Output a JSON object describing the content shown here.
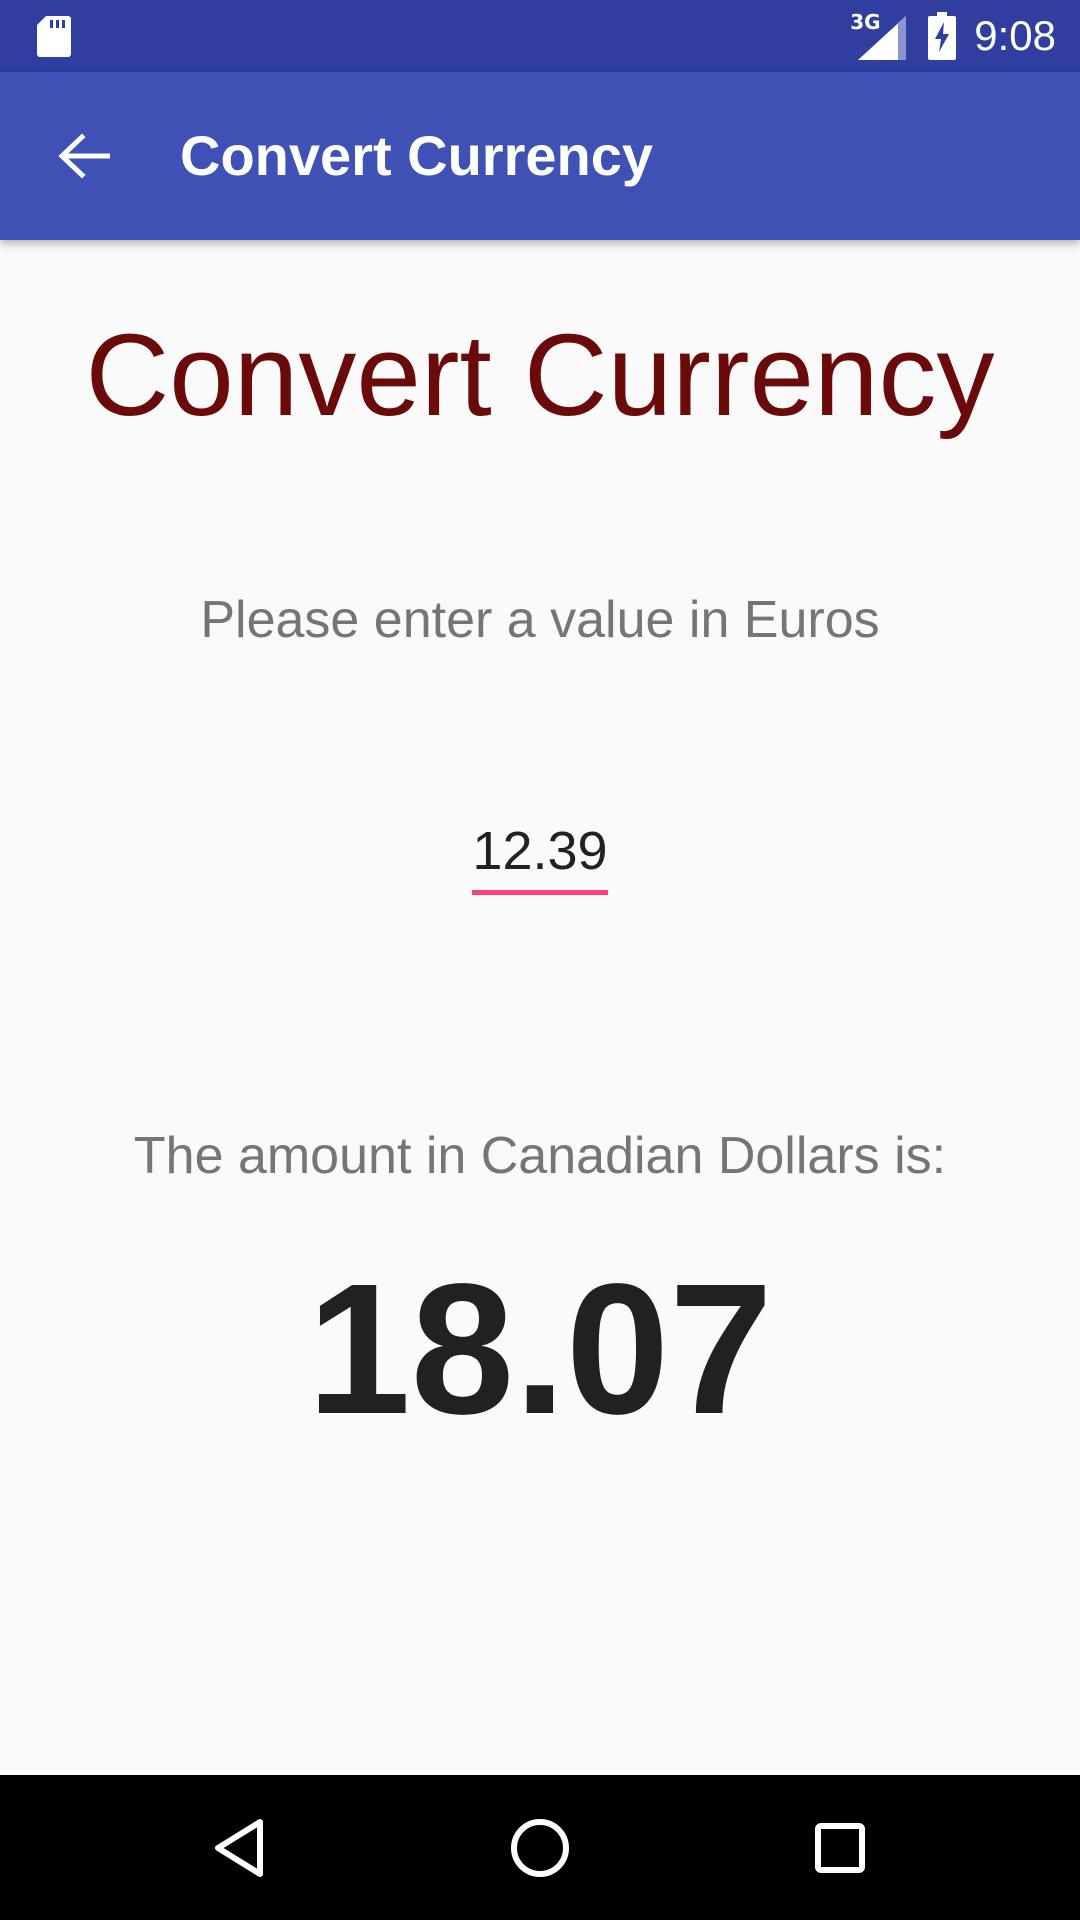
{
  "status_bar": {
    "time": "9:08",
    "network_label": "3G",
    "icons": [
      "sd-card-icon",
      "signal-icon",
      "battery-charging-icon"
    ],
    "background_color": "#303f9f"
  },
  "app_bar": {
    "title": "Convert Currency",
    "back_icon": "arrow-back-icon",
    "background_color": "#3f51b5"
  },
  "main": {
    "heading": "Convert Currency",
    "heading_color": "#6b0a0a",
    "prompt": "Please enter a value in Euros",
    "euro_input": {
      "value": "12.39",
      "underline_color": "#ff4081"
    },
    "result_label": "The amount in Canadian Dollars is:",
    "result_value": "18.07"
  },
  "nav_bar": {
    "icons": [
      "nav-back-icon",
      "nav-home-icon",
      "nav-recents-icon"
    ]
  }
}
